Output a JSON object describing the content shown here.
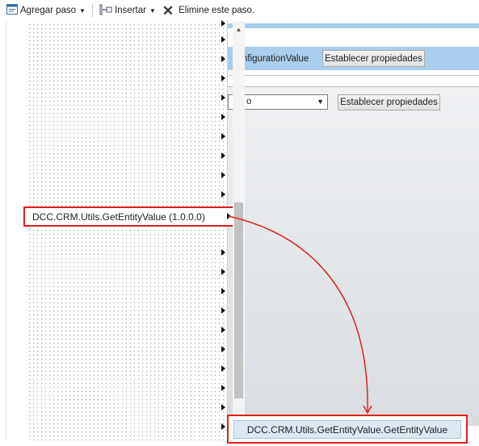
{
  "toolbar": {
    "add_step_label": "Agregar paso",
    "insert_label": "Insertar",
    "delete_label": "Elimine este paso."
  },
  "designer": {
    "step_text": "nfigurationValue",
    "set_properties_1": "Establecer propiedades",
    "dropdown_value": "o",
    "set_properties_2": "Establecer propiedades"
  },
  "menu": {
    "highlighted_item": "DCC.CRM.Utils.GetEntityValue (1.0.0.0)",
    "submenu_item": "DCC.CRM.Utils.GetEntityValue.GetEntityValue"
  },
  "colors": {
    "highlight_border": "#e02020",
    "step_bar": "#a9cdec"
  }
}
